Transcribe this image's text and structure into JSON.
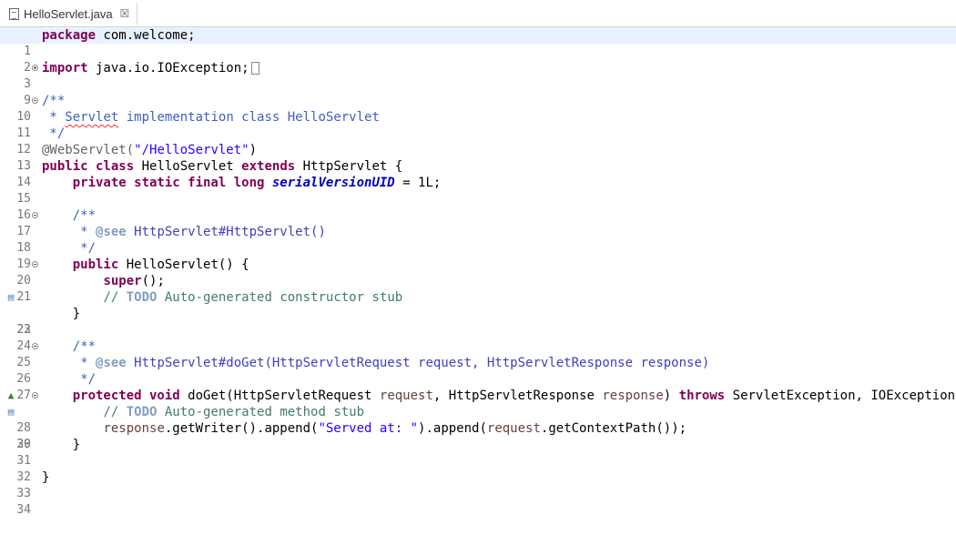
{
  "tab": {
    "title": "HelloServlet.java",
    "close_glyph": "☒"
  },
  "editor": {
    "line_numbers": [
      "1",
      "2",
      "3",
      "9",
      "10",
      "11",
      "12",
      "13",
      "14",
      "15",
      "16",
      "17",
      "18",
      "19",
      "20",
      "21",
      "22",
      "23",
      "24",
      "25",
      "26",
      "27",
      "28",
      "29",
      "30",
      "31",
      "32",
      "33",
      "34"
    ],
    "code": {
      "l1_kw": "package",
      "l1_rest": " com.welcome;",
      "l3_kw": "import",
      "l3_rest": " java.io.IOException;",
      "l10": "/**",
      "l11_a": " * ",
      "l11_word": "Servlet",
      "l11_b": " implementation class HelloServlet",
      "l12": " */",
      "l13_ann": "@WebServlet(",
      "l13_str": "\"/HelloServlet\"",
      "l13_end": ")",
      "l14_kw1": "public class",
      "l14_a": " HelloServlet ",
      "l14_kw2": "extends",
      "l14_b": " HttpServlet {",
      "l15_kw": "private static final long",
      "l15_fld": "serialVersionUID",
      "l15_rest": " = 1L;",
      "l17": "/**",
      "l18_a": " * ",
      "l18_tag": "@see",
      "l18_link": " HttpServlet#HttpServlet()",
      "l19": " */",
      "l20_kw": "public",
      "l20_rest": " HelloServlet() {",
      "l21_kw": "super",
      "l21_rest": "();",
      "l22_a": "// ",
      "l22_todo": "TODO",
      "l22_b": " Auto-generated constructor stub",
      "l23": "}",
      "l25": "/**",
      "l26_a": " * ",
      "l26_tag": "@see",
      "l26_link": " HttpServlet#doGet(HttpServletRequest request, HttpServletResponse response)",
      "l27": " */",
      "l28_kw1": "protected void",
      "l28_a": " doGet(HttpServletRequest ",
      "l28_v1": "request",
      "l28_b": ", HttpServletResponse ",
      "l28_v2": "response",
      "l28_c": ") ",
      "l28_kw2": "throws",
      "l28_d": " ServletException, IOException {",
      "l29_a": "// ",
      "l29_todo": "TODO",
      "l29_b": " Auto-generated method stub",
      "l30_v1": "response",
      "l30_a": ".getWriter().append(",
      "l30_str": "\"Served at: \"",
      "l30_b": ").append(",
      "l30_v2": "request",
      "l30_c": ".getContextPath());",
      "l31": "}",
      "l33": "}"
    }
  },
  "colors": {
    "keyword": "#7f0055",
    "comment": "#3f7f5f",
    "javadoc": "#3f5fbf",
    "string": "#2a00ff",
    "field": "#0000c0",
    "variable": "#6a3e3e",
    "current_line": "#e8f2fe"
  },
  "icons": {
    "file_tab": "java-file-icon",
    "task_marker": "task-icon",
    "override_marker": "override-triangle-icon"
  }
}
